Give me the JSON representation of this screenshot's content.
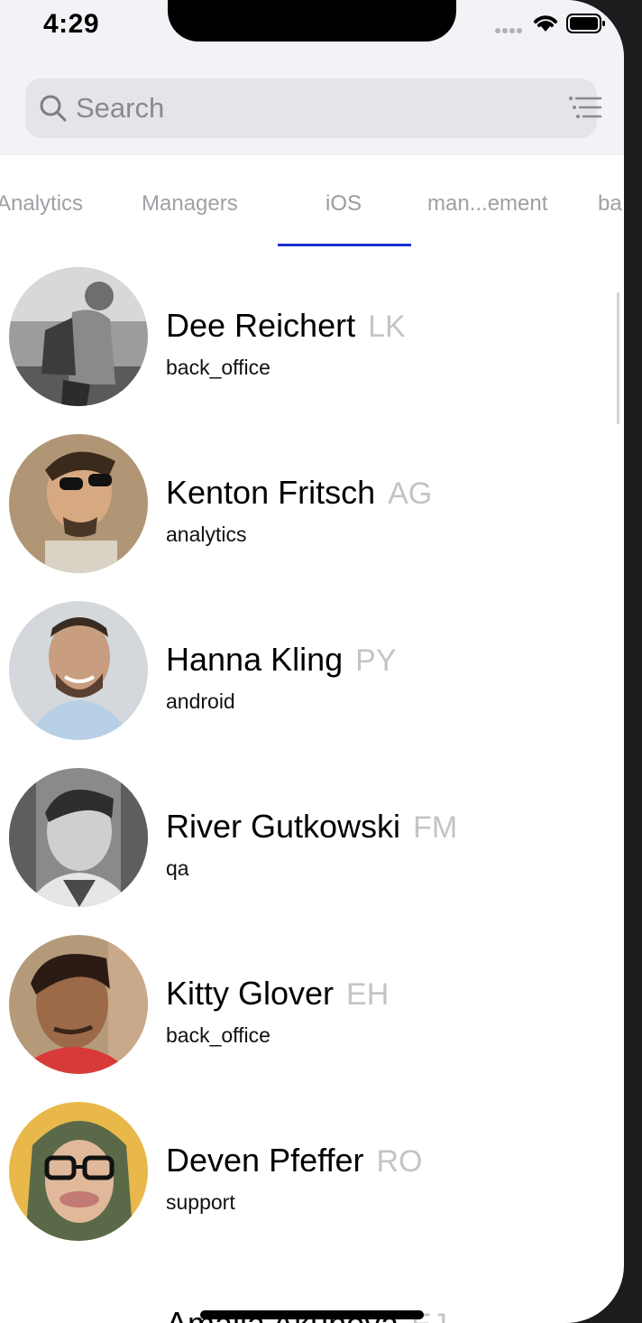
{
  "status_bar": {
    "time": "4:29"
  },
  "search": {
    "placeholder": "Search",
    "value": ""
  },
  "tabs": [
    {
      "label": "Analytics",
      "active": false
    },
    {
      "label": "Managers",
      "active": false
    },
    {
      "label": "iOS",
      "active": true
    },
    {
      "label": "man...ement",
      "active": false
    },
    {
      "label": "ba",
      "active": false
    }
  ],
  "contacts": [
    {
      "name": "Dee Reichert",
      "code": "LK",
      "department": "back_office"
    },
    {
      "name": "Kenton Fritsch",
      "code": "AG",
      "department": "analytics"
    },
    {
      "name": "Hanna Kling",
      "code": "PY",
      "department": "android"
    },
    {
      "name": "River Gutkowski",
      "code": "FM",
      "department": "qa"
    },
    {
      "name": "Kitty Glover",
      "code": "EH",
      "department": "back_office"
    },
    {
      "name": "Deven Pfeffer",
      "code": "RO",
      "department": "support"
    }
  ],
  "partial_contact": {
    "name": "Amalia Akunova",
    "code": "EJ"
  },
  "colors": {
    "accent": "#1a2fd1",
    "header_bg": "#f2f2f7",
    "search_bg": "#e4e4e9",
    "code_gray": "#c4c4c8"
  }
}
